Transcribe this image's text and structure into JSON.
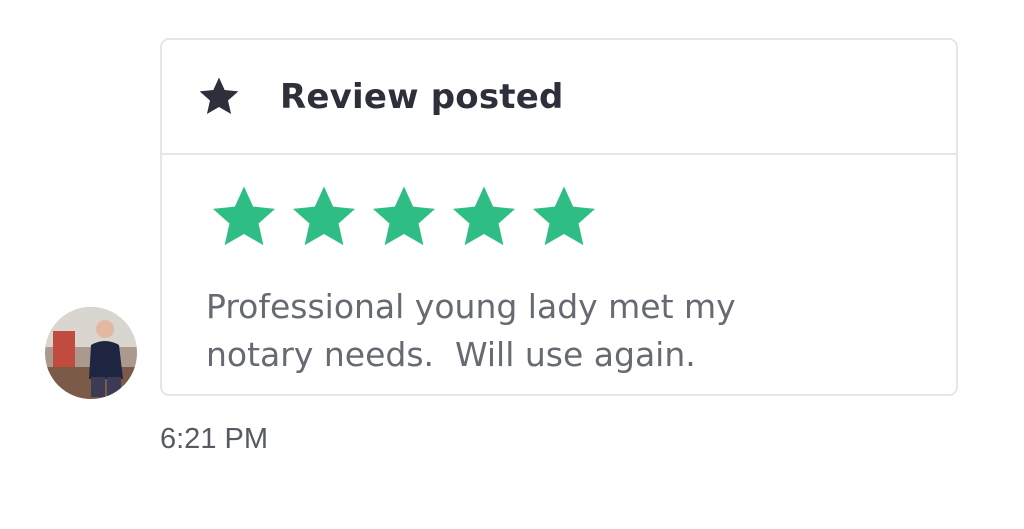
{
  "review_card": {
    "header": {
      "icon": "star-icon",
      "title": "Review posted"
    },
    "rating": {
      "value": 5,
      "max": 5,
      "color": "#2ebd85"
    },
    "text": "Professional young lady met my\nnotary needs.  Will use again."
  },
  "avatar": {
    "icon": "user-photo"
  },
  "timestamp": "6:21 PM"
}
